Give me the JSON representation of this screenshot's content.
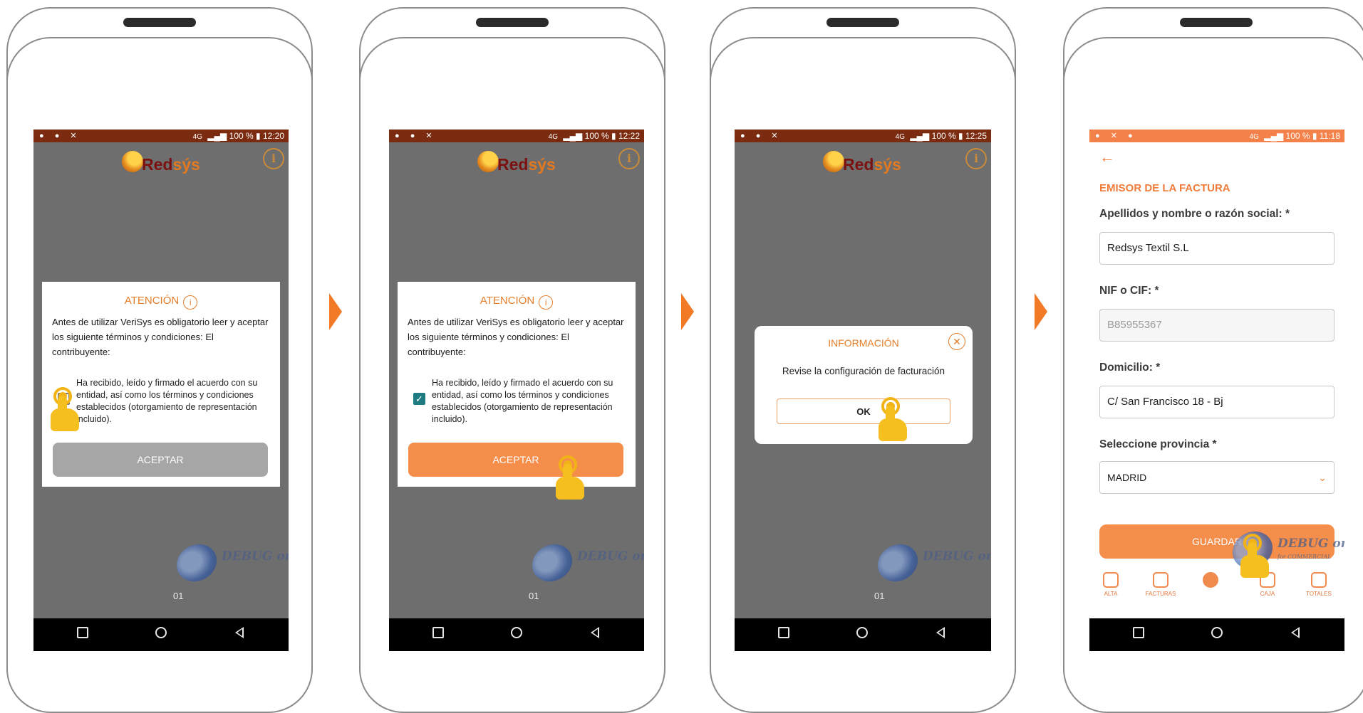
{
  "steps": [
    {
      "status": {
        "network": "4G",
        "battery": "100 %",
        "time": "12:20"
      },
      "logo": {
        "brand_main": "Red",
        "brand_accent": "sýs"
      },
      "dialog": {
        "title": "ATENCIÓN",
        "body": "Antes de utilizar VeriSys es obligatorio leer y aceptar los siguiente términos y condiciones: El contribuyente:",
        "checkbox_text": "Ha recibido, leído y firmado el acuerdo con su entidad, así como los términos y condiciones establecidos (otorgamiento de representación incluido).",
        "checked": false,
        "button": "ACEPTAR"
      },
      "watermark": {
        "title": "DEBUG",
        "suffix": "only"
      },
      "build_label": "01"
    },
    {
      "status": {
        "network": "4G",
        "battery": "100 %",
        "time": "12:22"
      },
      "logo": {
        "brand_main": "Red",
        "brand_accent": "sýs"
      },
      "dialog": {
        "title": "ATENCIÓN",
        "body": "Antes de utilizar VeriSys es obligatorio leer y aceptar los siguiente términos y condiciones: El contribuyente:",
        "checkbox_text": "Ha recibido, leído y firmado el acuerdo con su entidad, así como los términos y condiciones establecidos (otorgamiento de representación incluido).",
        "checked": true,
        "button": "ACEPTAR"
      },
      "watermark": {
        "title": "DEBUG",
        "suffix": "only"
      },
      "build_label": "01"
    },
    {
      "status": {
        "network": "4G",
        "battery": "100 %",
        "time": "12:25"
      },
      "logo": {
        "brand_main": "Red",
        "brand_accent": "sýs"
      },
      "info_dialog": {
        "title": "INFORMACIÓN",
        "message": "Revise la configuración de facturación",
        "ok": "OK"
      },
      "watermark": {
        "title": "DEBUG",
        "suffix": "only"
      },
      "build_label": "01"
    },
    {
      "status": {
        "network": "4G",
        "battery": "100 %",
        "time": "11:18"
      },
      "section_title": "EMISOR DE LA FACTURA",
      "fields": {
        "name_label": "Apellidos y nombre o razón social: *",
        "name_value": "Redsys Textil S.L",
        "nif_label": "NIF o CIF: *",
        "nif_value": "B85955367",
        "address_label": "Domicilio: *",
        "address_value": "C/ San Francisco 18 - Bj",
        "province_label": "Seleccione provincia *",
        "province_value": "MADRID"
      },
      "save_button": "GUARDAR",
      "tabs": [
        "ALTA",
        "FACTURAS",
        "CAJA",
        "TOTALES"
      ],
      "watermark": {
        "title": "DEBUG",
        "suffix": "only",
        "sub": "for COMMERCIAL"
      }
    }
  ],
  "colors": {
    "accent": "#f58d4b",
    "status_dark": "#7a2b10",
    "status_orange": "#f4804a",
    "teal": "#1e7b82"
  }
}
